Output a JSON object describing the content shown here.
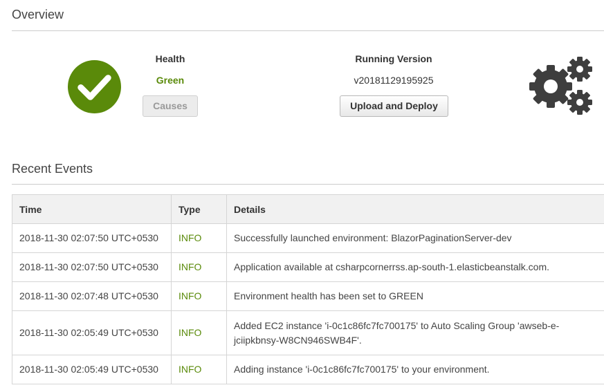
{
  "overview": {
    "title": "Overview",
    "health": {
      "label": "Health",
      "status": "Green",
      "status_color": "#5a8a0a",
      "icon": "check-circle-icon",
      "icon_color": "#5a8a0a",
      "causes_button": "Causes"
    },
    "running_version": {
      "label": "Running Version",
      "version": "v20181129195925",
      "deploy_button": "Upload and Deploy"
    },
    "gears_icon": "gears-icon"
  },
  "recent_events": {
    "title": "Recent Events",
    "columns": [
      "Time",
      "Type",
      "Details"
    ],
    "rows": [
      {
        "time": "2018-11-30 02:07:50 UTC+0530",
        "type": "INFO",
        "details": "Successfully launched environment: BlazorPaginationServer-dev"
      },
      {
        "time": "2018-11-30 02:07:50 UTC+0530",
        "type": "INFO",
        "details": "Application available at csharpcornerrss.ap-south-1.elasticbeanstalk.com."
      },
      {
        "time": "2018-11-30 02:07:48 UTC+0530",
        "type": "INFO",
        "details": "Environment health has been set to GREEN"
      },
      {
        "time": "2018-11-30 02:05:49 UTC+0530",
        "type": "INFO",
        "details": "Added EC2 instance 'i-0c1c86fc7fc700175' to Auto Scaling Group 'awseb-e-jciipkbnsy-W8CN946SWB4F'."
      },
      {
        "time": "2018-11-30 02:05:49 UTC+0530",
        "type": "INFO",
        "details": "Adding instance 'i-0c1c86fc7fc700175' to your environment."
      }
    ],
    "info_color": "#5a8a0a"
  }
}
